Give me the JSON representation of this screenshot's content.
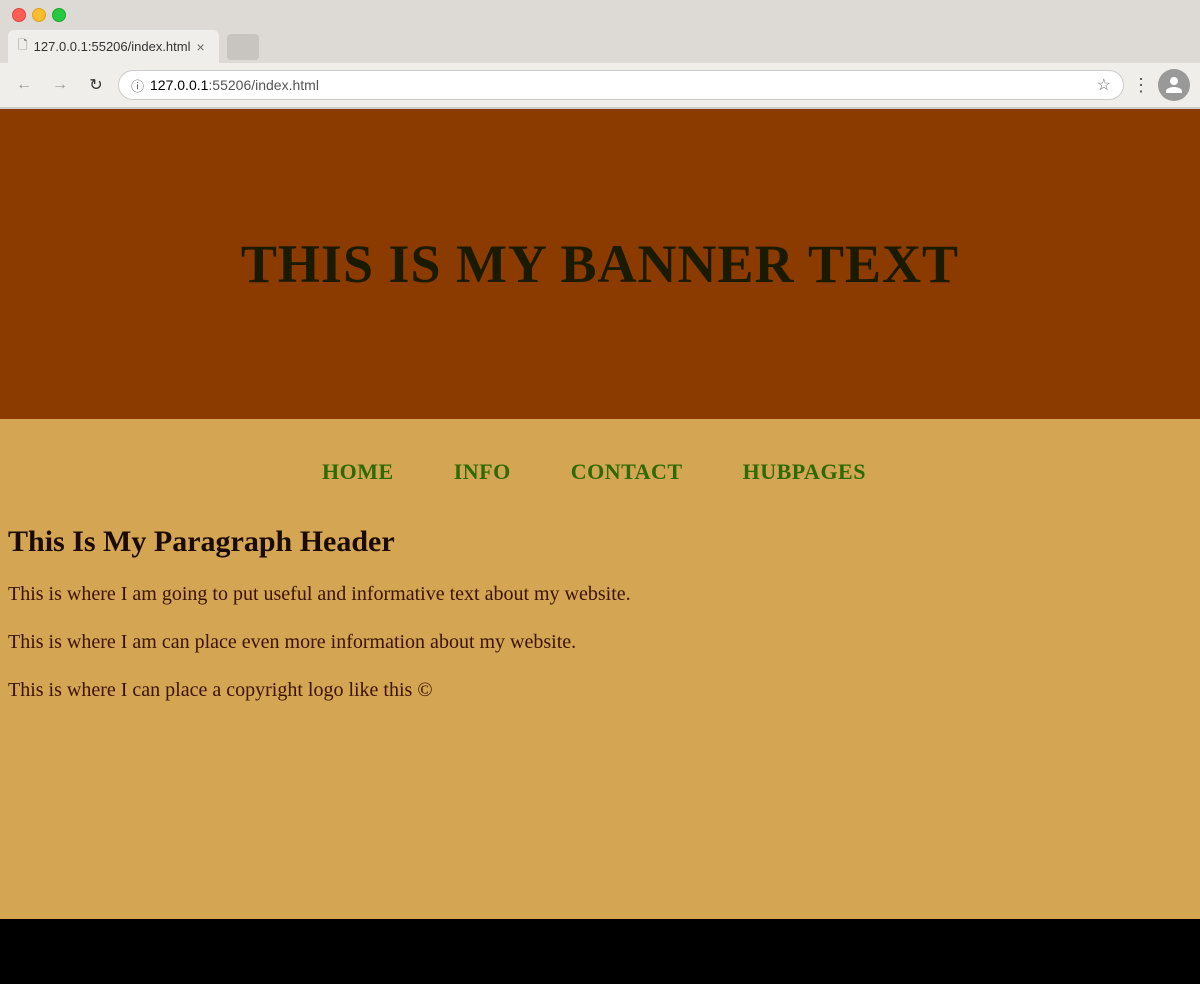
{
  "browser": {
    "url_host": "127.0.0.1",
    "url_path": ":55206/index.html",
    "tab_title": "127.0.0.1:55206/index.html",
    "favicon_char": "🗋"
  },
  "banner": {
    "text": "THIS IS MY BANNER TEXT"
  },
  "nav": {
    "items": [
      {
        "label": "HOME",
        "id": "home"
      },
      {
        "label": "INFO",
        "id": "info"
      },
      {
        "label": "CONTACT",
        "id": "contact"
      },
      {
        "label": "HUBPAGES",
        "id": "hubpages"
      }
    ]
  },
  "main": {
    "paragraph_header": "This Is My Paragraph Header",
    "paragraph1": "This is where I am going to put useful and informative text about my website.",
    "paragraph2": "This is where I am can place even more information about my website.",
    "paragraph3": "This is where I can place a copyright logo like this ©"
  },
  "colors": {
    "banner_bg": "#8B3A00",
    "content_bg": "#D4A553",
    "nav_text": "#2d6a00",
    "body_text": "#3b1200",
    "header_text": "#1a0a00"
  }
}
